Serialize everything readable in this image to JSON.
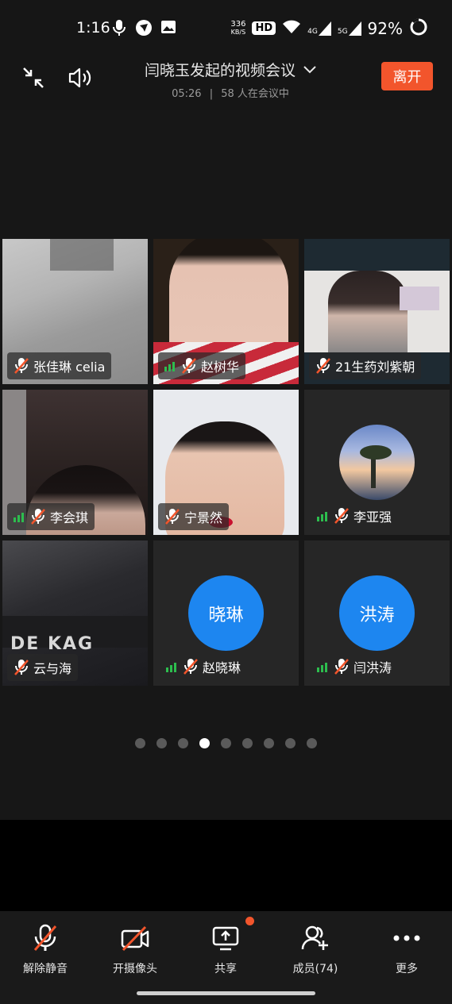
{
  "status_bar": {
    "time": "1:16",
    "speed_value": "336",
    "speed_unit": "KB/S",
    "hd_label": "HD",
    "network_4g": "4G",
    "network_5g": "5G",
    "battery": "92%"
  },
  "header": {
    "title": "闫晓玉发起的视频会议",
    "duration": "05:26",
    "participants_text": "58 人在会议中",
    "leave_label": "离开"
  },
  "tiles": [
    {
      "name": "张佳琳 celia",
      "avatar_text": ""
    },
    {
      "name": "赵树华",
      "avatar_text": ""
    },
    {
      "name": "21生药刘紫朝",
      "avatar_text": ""
    },
    {
      "name": "李会琪",
      "avatar_text": ""
    },
    {
      "name": "宁景然",
      "avatar_text": ""
    },
    {
      "name": "李亚强",
      "avatar_text": ""
    },
    {
      "name": "云与海",
      "avatar_text": ""
    },
    {
      "name": "赵晓琳",
      "avatar_text": "晓琳"
    },
    {
      "name": "闫洪涛",
      "avatar_text": "洪涛"
    }
  ],
  "pagination": {
    "total": 9,
    "active_index": 3
  },
  "toolbar": {
    "unmute_label": "解除静音",
    "camera_label": "开摄像头",
    "share_label": "共享",
    "members_label": "成员(74)",
    "more_label": "更多"
  },
  "colors": {
    "accent_orange": "#f2552c",
    "avatar_blue": "#1d86f0",
    "signal_green": "#2dbd4e",
    "mute_red": "#f2552c"
  },
  "icons": [
    "minimize-icon",
    "speaker-icon",
    "chevron-down-icon",
    "mic-muted-icon",
    "camera-off-icon",
    "share-screen-icon",
    "add-member-icon",
    "more-icon",
    "signal-icon"
  ]
}
